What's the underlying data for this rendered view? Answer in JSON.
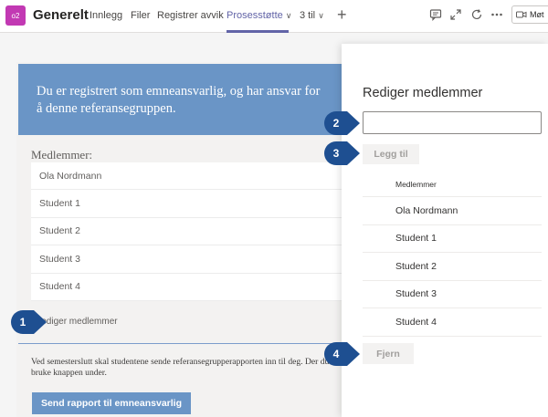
{
  "topbar": {
    "team_avatar": "o2",
    "team_name": "Generelt",
    "tabs": [
      {
        "label": "Innlegg"
      },
      {
        "label": "Filer"
      },
      {
        "label": "Registrer avvik"
      },
      {
        "label": "Prosesstøtte",
        "active": true
      },
      {
        "label": "3 til"
      }
    ],
    "meet_label": "Møt",
    "icons": [
      "chat-icon",
      "expand-icon",
      "refresh-icon",
      "more-icon",
      "video-icon"
    ]
  },
  "main": {
    "banner": "Du er registrert som emneansvarlig, og har ansvar for å denne referansegruppen.",
    "members_label": "Medlemmer:",
    "members": [
      "Ola Nordmann",
      "Student 1",
      "Student 2",
      "Student 3",
      "Student 4"
    ],
    "edit_link": "Rediger medlemmer",
    "semester_text": "Ved semesterslutt skal studentene sende referansegrupperapporten inn til deg. Der du bruke knappen under.",
    "send_button": "Send rapport til emneansvarlig"
  },
  "panel": {
    "title": "Rediger medlemmer",
    "input_value": "",
    "add_button": "Legg til",
    "column_header": "Medlemmer",
    "members": [
      "Ola Nordmann",
      "Student 1",
      "Student 2",
      "Student 3",
      "Student 4"
    ],
    "remove_button": "Fjern"
  },
  "markers": [
    "1",
    "2",
    "3",
    "4"
  ],
  "colors": {
    "accent": "#6264a7",
    "banner": "#6a95c6",
    "marker": "#1e4f91"
  }
}
